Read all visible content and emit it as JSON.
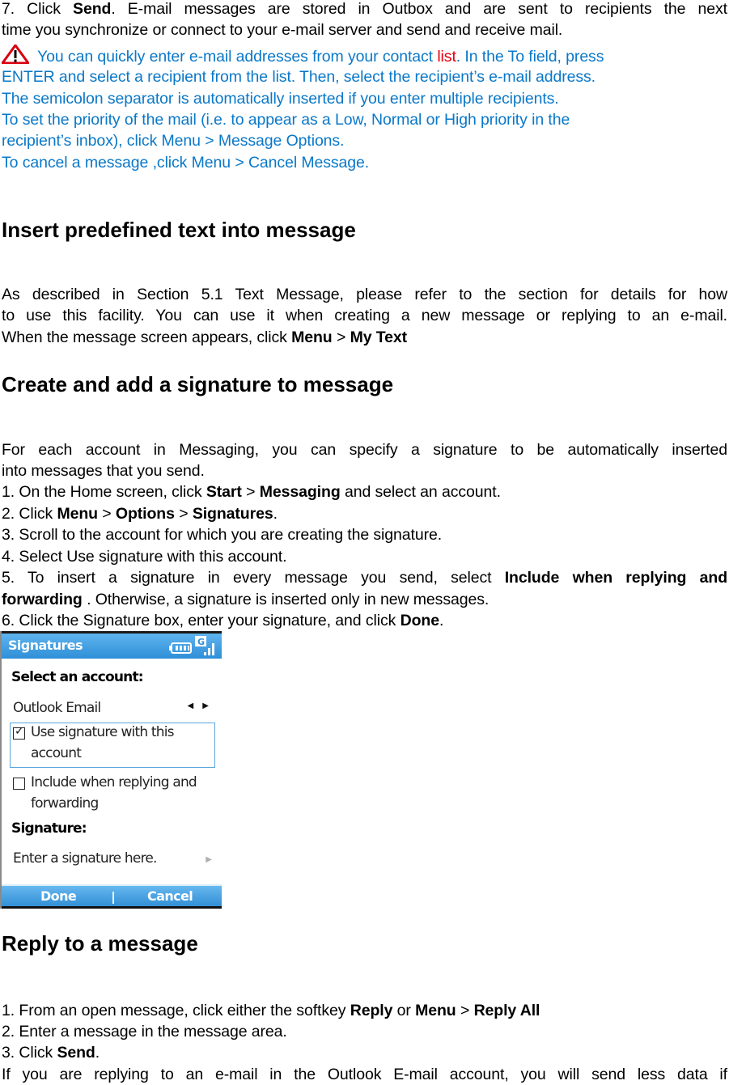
{
  "intro": {
    "step7": {
      "prefix": "7. Click ",
      "bold": "Send",
      "suffix": ". E-mail messages are stored in Outbox and are sent to recipients the next",
      "line2": "time you synchronize or connect to your e-mail server and send and receive mail."
    },
    "note": {
      "icon": "warning-icon",
      "line1_a": "You can quickly enter e-mail addresses from your contact ",
      "line1_link": "list",
      "line1_b": ". In the To field, press",
      "line2": "ENTER and select a recipient from the list. Then, select the recipient’s e-mail address.",
      "line3": "The semicolon separator is automatically inserted if you enter multiple recipients.",
      "line4": "To set the priority of the mail (i.e. to appear as a Low, Normal or High priority in the",
      "line5": "recipient’s inbox), click Menu > Message Options.",
      "line6": "To cancel a message ,click Menu > Cancel Message."
    },
    "colors": {
      "note_blue": "#0a78c8",
      "link_red": "#e8000f"
    }
  },
  "section_predefined": {
    "heading": "Insert predefined text into message",
    "line1": "As described in Section 5.1 Text Message, please refer to the section for details for how",
    "line2": "to use this facility. You can use it when creating a new message or replying to an e-mail.",
    "line3_prefix": "When the message screen appears, click ",
    "line3_b1": "Menu",
    "line3_sep": " > ",
    "line3_b2": "My Text"
  },
  "section_signature": {
    "heading": "Create and add a signature to message",
    "intro1": "For each account in Messaging, you can specify a signature to be automatically inserted",
    "intro2": "into messages that you send.",
    "step1": {
      "a": "1. On the Home screen, click ",
      "b1": "Start",
      "sep": " > ",
      "b2": "Messaging",
      "c": " and select an account."
    },
    "step2": {
      "a": "2. Click ",
      "b1": "Menu",
      "sep1": " > ",
      "b2": "Options",
      "sep2": " > ",
      "b3": "Signatures",
      "c": "."
    },
    "step3": "3. Scroll to the account for which you are creating the signature.",
    "step4": "4. Select Use signature with this account.",
    "step5": {
      "a": "5. To insert a signature in every message you send, select ",
      "b1": "Include when replying and",
      "b2": "forwarding",
      "c": " . Otherwise, a signature is inserted only in new messages."
    },
    "step6": {
      "a": "6. Click the Signature box, enter your signature, and click ",
      "b": "Done",
      "c": "."
    }
  },
  "phone": {
    "title": "Signatures",
    "status_icons": [
      "battery-icon",
      "gprs-icon",
      "signal-strength-icon"
    ],
    "gprs_label": "G",
    "select_account_label": "Select an account:",
    "account_value": "Outlook Email",
    "account_arrows": "◀ ▶",
    "use_signature": {
      "label_line1": "Use signature with this",
      "label_line2": "account",
      "checked": true
    },
    "include_replying": {
      "label_line1": "Include when replying and",
      "label_line2": "forwarding",
      "checked": false
    },
    "signature_label": "Signature:",
    "signature_placeholder": "Enter a signature here.",
    "softkey_left": "Done",
    "softkey_right": "Cancel",
    "colors": {
      "title_bar": "#3f9fe2",
      "softkey_bar": "#3a94da",
      "selection_border": "#5aa6de"
    }
  },
  "section_reply": {
    "heading": "Reply to a message",
    "step1": {
      "a": "1. From an open message, click either the softkey ",
      "b1": "Reply",
      "mid": " or ",
      "b2": "Menu",
      "sep": " > ",
      "b3": "Reply All"
    },
    "step2": "2. Enter a message in the message area.",
    "step3": {
      "a": "3. Click ",
      "b": "Send",
      "c": "."
    },
    "para": "If you are replying to an e-mail in the Outlook E-mail account, you will send less data if"
  }
}
